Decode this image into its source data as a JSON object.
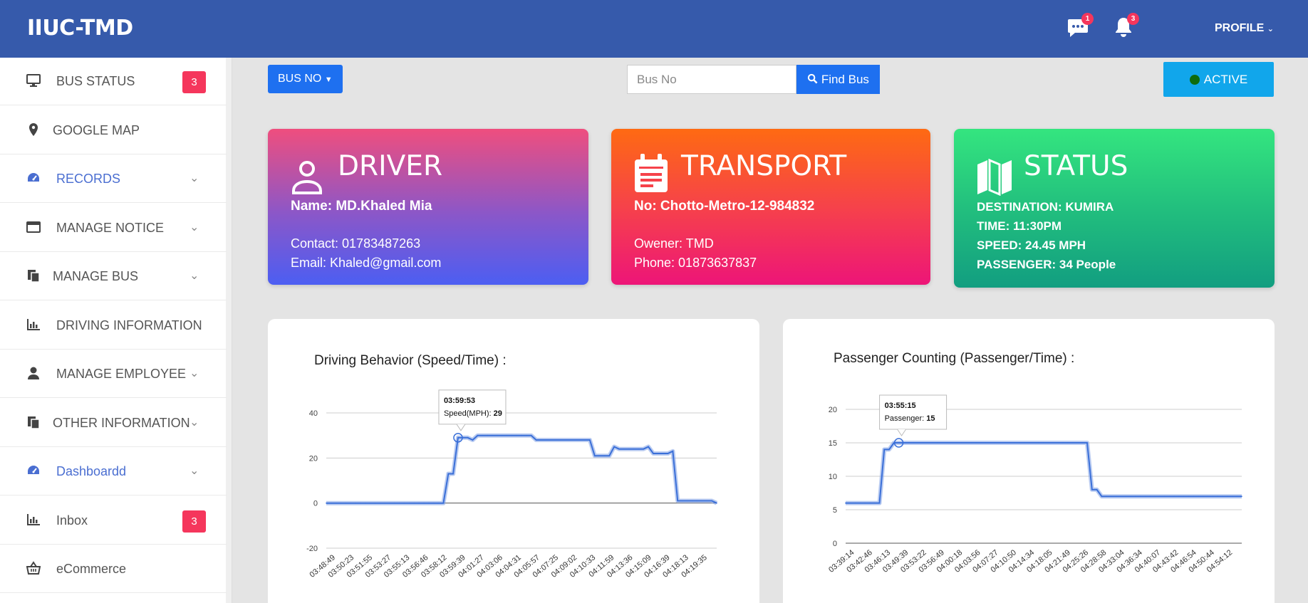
{
  "header": {
    "brand": "IIUC-TMD",
    "messages_badge": "1",
    "notifications_badge": "3",
    "profile_label": "PROFILE"
  },
  "sidebar": {
    "items": [
      {
        "label": "BUS STATUS",
        "icon": "monitor-icon",
        "badge": "3"
      },
      {
        "label": "GOOGLE MAP",
        "icon": "map-pin-icon"
      },
      {
        "label": "RECORDS",
        "icon": "dashboard-icon",
        "chevron": true
      },
      {
        "label": "MANAGE NOTICE",
        "icon": "window-icon",
        "chevron": true
      },
      {
        "label": "MANAGE BUS",
        "icon": "copy-icon",
        "chevron": true
      },
      {
        "label": "DRIVING INFORMATION",
        "icon": "bar-chart-icon"
      },
      {
        "label": "MANAGE EMPLOYEE",
        "icon": "user-icon",
        "chevron": true
      },
      {
        "label": "OTHER INFORMATION",
        "icon": "copy-icon",
        "chevron": true
      },
      {
        "label": "Dashboardd",
        "icon": "dashboard-icon",
        "chevron": true
      },
      {
        "label": "Inbox",
        "icon": "bar-chart-icon",
        "badge": "3"
      },
      {
        "label": "eCommerce",
        "icon": "basket-icon"
      }
    ]
  },
  "toolbar": {
    "bus_no_label": "BUS NO",
    "search_placeholder": "Bus No",
    "find_label": "Find Bus",
    "active_label": "ACTIVE"
  },
  "cards": {
    "driver": {
      "title": "DRIVER",
      "name": "Name: MD.Khaled Mia",
      "contact": "Contact: 01783487263",
      "email": "Email: Khaled@gmail.com"
    },
    "transport": {
      "title": "TRANSPORT",
      "number": "No: Chotto-Metro-12-984832",
      "owner": "Owener: TMD",
      "phone": "Phone: 01873637837"
    },
    "status": {
      "title": "STATUS",
      "destination": "DESTINATION: KUMIRA",
      "time": "TIME: 11:30PM",
      "speed": "SPEED: 24.45 MPH",
      "passenger": "PASSENGER: 34 People"
    }
  },
  "colors": {
    "header": "#365aab",
    "accent": "#4a6ed1",
    "badge": "#f5365c",
    "line": "#3a6fd8"
  },
  "chart_data": [
    {
      "type": "line",
      "title": "Driving Behavior (Speed/Time) :",
      "ylim": [
        -20,
        40
      ],
      "yticks": [
        -20,
        0,
        20,
        40
      ],
      "tick_labels": [
        "03:48:49",
        "03:50:23",
        "03:51:55",
        "03:53:27",
        "03:55:13",
        "03:56:46",
        "03:58:12",
        "03:59:39",
        "04:01:27",
        "04:03:06",
        "04:04:31",
        "04:05:57",
        "04:07:25",
        "04:09:02",
        "04:10:33",
        "04:11:59",
        "04:13:36",
        "04:15:09",
        "04:16:39",
        "04:18:13",
        "04:19:35"
      ],
      "values": [
        0,
        0,
        0,
        0,
        0,
        0,
        0,
        0,
        0,
        0,
        0,
        0,
        0,
        0,
        0,
        0,
        0,
        0,
        0,
        0,
        0,
        0,
        0,
        0,
        0,
        13,
        13,
        29,
        29,
        29,
        28,
        30,
        30,
        30,
        30,
        30,
        30,
        30,
        30,
        30,
        30,
        30,
        30,
        28,
        28,
        28,
        28,
        28,
        28,
        28,
        28,
        28,
        28,
        28,
        28,
        21,
        21,
        21,
        21,
        25,
        24,
        24,
        24,
        24,
        24,
        24,
        25,
        22,
        22,
        22,
        22,
        23,
        1,
        1,
        1,
        1,
        1,
        1,
        1,
        1,
        0
      ],
      "tooltip": {
        "time": "03:59:53",
        "label": "Speed(MPH):",
        "value": "29"
      }
    },
    {
      "type": "line",
      "title": "Passenger Counting (Passenger/Time) :",
      "ylim": [
        0,
        20
      ],
      "yticks": [
        0,
        5,
        10,
        15,
        20
      ],
      "tick_labels": [
        "03:39:14",
        "03:42:46",
        "03:46:13",
        "03:49:39",
        "03:53:22",
        "03:56:49",
        "04:00:18",
        "04:03:56",
        "04:07:27",
        "04:10:50",
        "04:14:34",
        "04:18:05",
        "04:21:49",
        "04:25:26",
        "04:28:58",
        "04:33:04",
        "04:36:34",
        "04:40:07",
        "04:43:42",
        "04:46:54",
        "04:50:44",
        "04:54:12"
      ],
      "values": [
        6,
        6,
        6,
        6,
        6,
        6,
        6,
        6,
        14,
        14,
        15,
        15,
        15,
        15,
        15,
        15,
        15,
        15,
        15,
        15,
        15,
        15,
        15,
        15,
        15,
        15,
        15,
        15,
        15,
        15,
        15,
        15,
        15,
        15,
        15,
        15,
        15,
        15,
        15,
        15,
        15,
        15,
        15,
        15,
        15,
        15,
        15,
        15,
        15,
        15,
        15,
        8,
        8,
        7,
        7,
        7,
        7,
        7,
        7,
        7,
        7,
        7,
        7,
        7,
        7,
        7,
        7,
        7,
        7,
        7,
        7,
        7,
        7,
        7,
        7,
        7,
        7,
        7,
        7,
        7,
        7,
        7,
        7
      ],
      "tooltip": {
        "time": "03:55:15",
        "label": "Passenger:",
        "value": "15"
      }
    }
  ]
}
